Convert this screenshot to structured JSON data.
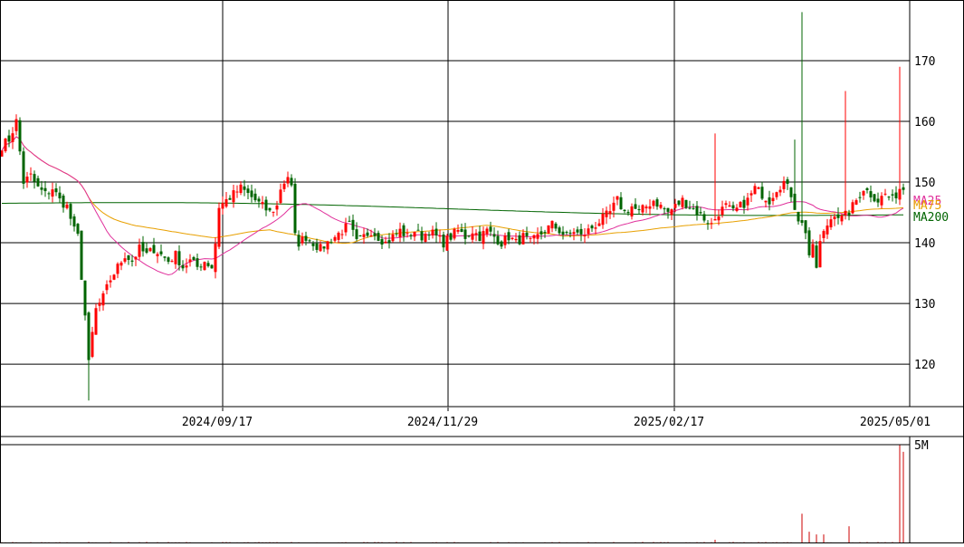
{
  "chart_data": {
    "type": "candlestick",
    "x_ticks": [
      "2024/09/17",
      "2024/11/29",
      "2025/02/17",
      "2025/05/01"
    ],
    "y_ticks": [
      120,
      130,
      140,
      150,
      160,
      170
    ],
    "ylim": [
      113,
      180
    ],
    "volume_ticks": [
      "5M"
    ],
    "volume_ylim": [
      0,
      5500000
    ],
    "legend": [
      "MA25",
      "MA75",
      "MA200"
    ],
    "colors": {
      "up": "#ff0000",
      "down": "#006400",
      "ma25": "#e0309b",
      "ma75": "#e8a000",
      "ma200": "#006400",
      "volume": "#cc0000",
      "grid": "#000000"
    },
    "anchors": [
      {
        "i": 0,
        "c": 156
      },
      {
        "i": 2,
        "c": 157
      },
      {
        "i": 4,
        "c": 160
      },
      {
        "i": 6,
        "c": 150
      },
      {
        "i": 8,
        "c": 151
      },
      {
        "i": 10,
        "c": 149
      },
      {
        "i": 12,
        "c": 148
      },
      {
        "i": 14,
        "c": 149
      },
      {
        "i": 16,
        "c": 147
      },
      {
        "i": 18,
        "c": 146
      },
      {
        "i": 20,
        "c": 142
      },
      {
        "i": 21,
        "c": 141
      },
      {
        "i": 23,
        "c": 128
      },
      {
        "i": 24,
        "c": 120
      },
      {
        "i": 25,
        "c": 125
      },
      {
        "i": 26,
        "c": 129
      },
      {
        "i": 28,
        "c": 131
      },
      {
        "i": 30,
        "c": 134
      },
      {
        "i": 32,
        "c": 136
      },
      {
        "i": 34,
        "c": 138
      },
      {
        "i": 36,
        "c": 137
      },
      {
        "i": 38,
        "c": 139
      },
      {
        "i": 40,
        "c": 138
      },
      {
        "i": 42,
        "c": 139
      },
      {
        "i": 44,
        "c": 138
      },
      {
        "i": 46,
        "c": 137
      },
      {
        "i": 48,
        "c": 138
      },
      {
        "i": 50,
        "c": 136
      },
      {
        "i": 52,
        "c": 137
      },
      {
        "i": 54,
        "c": 136
      },
      {
        "i": 56,
        "c": 137
      },
      {
        "i": 58,
        "c": 136
      },
      {
        "i": 59,
        "c": 140
      },
      {
        "i": 60,
        "c": 146
      },
      {
        "i": 62,
        "c": 147
      },
      {
        "i": 64,
        "c": 148
      },
      {
        "i": 66,
        "c": 149
      },
      {
        "i": 68,
        "c": 148
      },
      {
        "i": 70,
        "c": 147
      },
      {
        "i": 72,
        "c": 146
      },
      {
        "i": 74,
        "c": 145
      },
      {
        "i": 76,
        "c": 146
      },
      {
        "i": 77,
        "c": 149
      },
      {
        "i": 79,
        "c": 151
      },
      {
        "i": 80,
        "c": 149
      },
      {
        "i": 81,
        "c": 141
      },
      {
        "i": 82,
        "c": 140
      },
      {
        "i": 84,
        "c": 141
      },
      {
        "i": 86,
        "c": 140
      },
      {
        "i": 88,
        "c": 139
      },
      {
        "i": 90,
        "c": 140
      },
      {
        "i": 92,
        "c": 141
      },
      {
        "i": 94,
        "c": 142
      },
      {
        "i": 96,
        "c": 143
      },
      {
        "i": 98,
        "c": 140
      },
      {
        "i": 100,
        "c": 141
      },
      {
        "i": 102,
        "c": 142
      },
      {
        "i": 104,
        "c": 141
      },
      {
        "i": 106,
        "c": 140
      },
      {
        "i": 108,
        "c": 141
      },
      {
        "i": 110,
        "c": 142
      },
      {
        "i": 112,
        "c": 141
      },
      {
        "i": 114,
        "c": 142
      },
      {
        "i": 116,
        "c": 141
      },
      {
        "i": 118,
        "c": 142
      },
      {
        "i": 120,
        "c": 141
      },
      {
        "i": 122,
        "c": 140
      },
      {
        "i": 124,
        "c": 141
      },
      {
        "i": 126,
        "c": 142
      },
      {
        "i": 128,
        "c": 141
      },
      {
        "i": 130,
        "c": 142
      },
      {
        "i": 132,
        "c": 141
      },
      {
        "i": 134,
        "c": 142
      },
      {
        "i": 136,
        "c": 141
      },
      {
        "i": 138,
        "c": 140
      },
      {
        "i": 140,
        "c": 141
      },
      {
        "i": 142,
        "c": 140
      },
      {
        "i": 144,
        "c": 141
      },
      {
        "i": 146,
        "c": 140
      },
      {
        "i": 148,
        "c": 141
      },
      {
        "i": 150,
        "c": 142
      },
      {
        "i": 152,
        "c": 143
      },
      {
        "i": 154,
        "c": 142
      },
      {
        "i": 156,
        "c": 141
      },
      {
        "i": 158,
        "c": 142
      },
      {
        "i": 160,
        "c": 141
      },
      {
        "i": 162,
        "c": 142
      },
      {
        "i": 164,
        "c": 143
      },
      {
        "i": 166,
        "c": 144
      },
      {
        "i": 168,
        "c": 145
      },
      {
        "i": 170,
        "c": 147
      },
      {
        "i": 172,
        "c": 145
      },
      {
        "i": 174,
        "c": 146
      },
      {
        "i": 176,
        "c": 145
      },
      {
        "i": 178,
        "c": 146
      },
      {
        "i": 180,
        "c": 147
      },
      {
        "i": 182,
        "c": 146
      },
      {
        "i": 184,
        "c": 145
      },
      {
        "i": 186,
        "c": 146
      },
      {
        "i": 188,
        "c": 147
      },
      {
        "i": 190,
        "c": 146
      },
      {
        "i": 192,
        "c": 145
      },
      {
        "i": 194,
        "c": 144
      },
      {
        "i": 196,
        "c": 143
      },
      {
        "i": 198,
        "c": 145
      },
      {
        "i": 200,
        "c": 146
      },
      {
        "i": 202,
        "c": 145
      },
      {
        "i": 204,
        "c": 146
      },
      {
        "i": 206,
        "c": 147
      },
      {
        "i": 208,
        "c": 149
      },
      {
        "i": 210,
        "c": 148
      },
      {
        "i": 212,
        "c": 147
      },
      {
        "i": 214,
        "c": 149
      },
      {
        "i": 216,
        "c": 150
      },
      {
        "i": 218,
        "c": 148
      },
      {
        "i": 220,
        "c": 144
      },
      {
        "i": 222,
        "c": 142
      },
      {
        "i": 223,
        "c": 138
      },
      {
        "i": 224,
        "c": 139
      },
      {
        "i": 225,
        "c": 136
      },
      {
        "i": 226,
        "c": 140
      },
      {
        "i": 228,
        "c": 143
      },
      {
        "i": 230,
        "c": 145
      },
      {
        "i": 232,
        "c": 144
      },
      {
        "i": 234,
        "c": 145
      },
      {
        "i": 236,
        "c": 147
      },
      {
        "i": 238,
        "c": 149
      },
      {
        "i": 240,
        "c": 148
      },
      {
        "i": 242,
        "c": 147
      },
      {
        "i": 244,
        "c": 148
      },
      {
        "i": 246,
        "c": 147
      },
      {
        "i": 248,
        "c": 149
      }
    ],
    "spikes": [
      {
        "i": 197,
        "h": 158
      },
      {
        "i": 221,
        "h": 178
      },
      {
        "i": 219,
        "h": 157
      },
      {
        "i": 233,
        "h": 165
      },
      {
        "i": 248,
        "h": 169
      }
    ],
    "volume_spikes": [
      {
        "i": 221,
        "v": 1650000
      },
      {
        "i": 223,
        "v": 650000
      },
      {
        "i": 225,
        "v": 500000
      },
      {
        "i": 227,
        "v": 500000
      },
      {
        "i": 234,
        "v": 950000
      },
      {
        "i": 248,
        "v": 5500000
      },
      {
        "i": 249,
        "v": 5100000
      },
      {
        "i": 197,
        "v": 200000
      }
    ]
  }
}
